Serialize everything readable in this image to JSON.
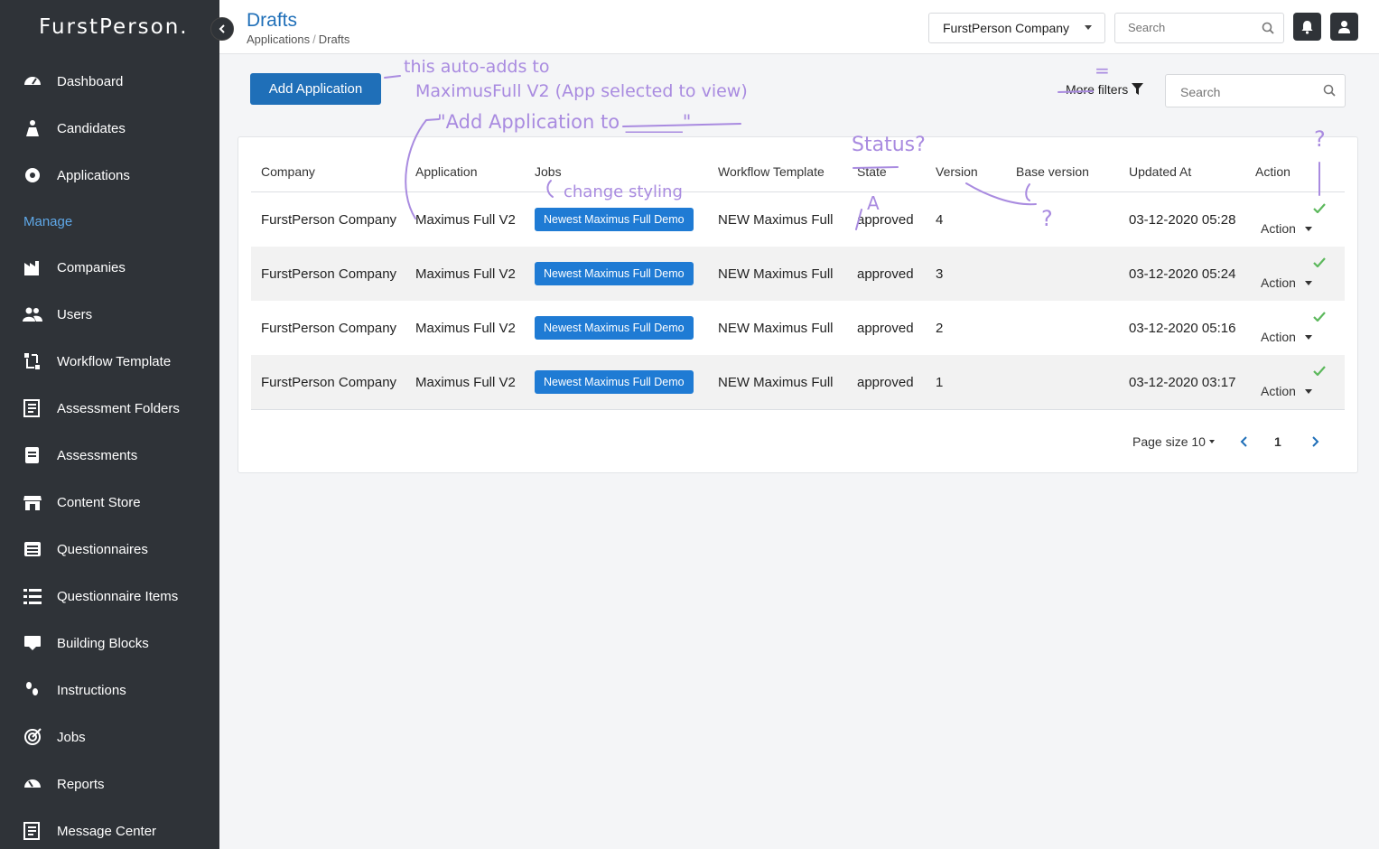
{
  "sidebar": {
    "logo": "FurstPerson.",
    "section_label": "Manage",
    "items": [
      {
        "label": "Dashboard",
        "icon": "dashboard-icon"
      },
      {
        "label": "Candidates",
        "icon": "candidates-icon"
      },
      {
        "label": "Applications",
        "icon": "applications-icon"
      },
      {
        "label": "Companies",
        "icon": "companies-icon"
      },
      {
        "label": "Users",
        "icon": "users-icon"
      },
      {
        "label": "Workflow Template",
        "icon": "workflow-icon"
      },
      {
        "label": "Assessment Folders",
        "icon": "assessment-folders-icon"
      },
      {
        "label": "Assessments",
        "icon": "assessments-icon"
      },
      {
        "label": "Content Store",
        "icon": "store-icon"
      },
      {
        "label": "Questionnaires",
        "icon": "questionnaires-icon"
      },
      {
        "label": "Questionnaire Items",
        "icon": "list-icon"
      },
      {
        "label": "Building Blocks",
        "icon": "building-blocks-icon"
      },
      {
        "label": "Instructions",
        "icon": "instructions-icon"
      },
      {
        "label": "Jobs",
        "icon": "target-icon"
      },
      {
        "label": "Reports",
        "icon": "reports-icon"
      },
      {
        "label": "Message Center",
        "icon": "message-icon"
      }
    ]
  },
  "header": {
    "title": "Drafts",
    "breadcrumb": [
      "Applications",
      "Drafts"
    ],
    "company_select": "FurstPerson Company",
    "search_placeholder": "Search"
  },
  "toolbar": {
    "add_label": "Add Application",
    "more_filters": "More filters",
    "search_placeholder": "Search"
  },
  "table": {
    "columns": [
      "Company",
      "Application",
      "Jobs",
      "Workflow Template",
      "State",
      "Version",
      "Base version",
      "Updated At",
      "Action"
    ],
    "rows": [
      {
        "company": "FurstPerson Company",
        "application": "Maximus Full V2",
        "job": "Newest Maximus Full Demo",
        "workflow": "NEW Maximus Full",
        "state": "approved",
        "version": "4",
        "base_version": "",
        "updated": "03-12-2020 05:28",
        "action": "Action"
      },
      {
        "company": "FurstPerson Company",
        "application": "Maximus Full V2",
        "job": "Newest Maximus Full Demo",
        "workflow": "NEW Maximus Full",
        "state": "approved",
        "version": "3",
        "base_version": "",
        "updated": "03-12-2020 05:24",
        "action": "Action"
      },
      {
        "company": "FurstPerson Company",
        "application": "Maximus Full V2",
        "job": "Newest Maximus Full Demo",
        "workflow": "NEW Maximus Full",
        "state": "approved",
        "version": "2",
        "base_version": "",
        "updated": "03-12-2020 05:16",
        "action": "Action"
      },
      {
        "company": "FurstPerson Company",
        "application": "Maximus Full V2",
        "job": "Newest Maximus Full Demo",
        "workflow": "NEW Maximus Full",
        "state": "approved",
        "version": "1",
        "base_version": "",
        "updated": "03-12-2020 03:17",
        "action": "Action"
      }
    ]
  },
  "pagination": {
    "page_size_label": "Page size",
    "page_size": "10",
    "current_page": "1"
  },
  "annotations": {
    "note1_line1": "this auto-adds to",
    "note1_line2": "MaximusFull V2 (App selected to view)",
    "note1_line3": "\"Add Application to ______\"",
    "change_styling": "change styling",
    "status": "Status?",
    "question": "?",
    "equals": "=",
    "letter_a": "A"
  },
  "colors": {
    "sidebar_bg": "#2f3338",
    "accent": "#1f6fb8",
    "tag": "#1f7bd4",
    "check": "#5cb85c",
    "annotation": "#a98be0"
  }
}
